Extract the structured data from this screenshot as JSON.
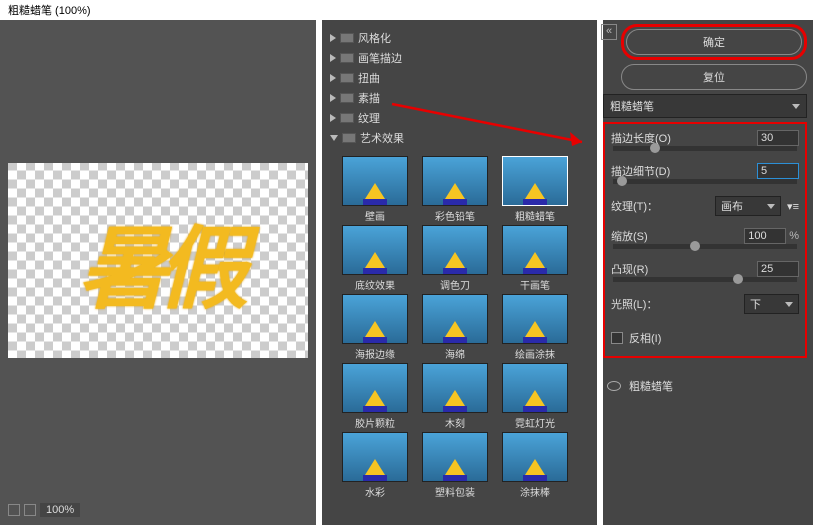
{
  "title": "粗糙蜡笔 (100%)",
  "preview": {
    "text": "暑假",
    "zoom": "100%"
  },
  "folders": [
    {
      "label": "风格化",
      "expanded": false
    },
    {
      "label": "画笔描边",
      "expanded": false
    },
    {
      "label": "扭曲",
      "expanded": false
    },
    {
      "label": "素描",
      "expanded": false
    },
    {
      "label": "纹理",
      "expanded": false
    },
    {
      "label": "艺术效果",
      "expanded": true
    }
  ],
  "thumbnails": [
    {
      "label": "壁画",
      "sel": false
    },
    {
      "label": "彩色铅笔",
      "sel": false
    },
    {
      "label": "粗糙蜡笔",
      "sel": true
    },
    {
      "label": "底纹效果",
      "sel": false
    },
    {
      "label": "调色刀",
      "sel": false
    },
    {
      "label": "干画笔",
      "sel": false
    },
    {
      "label": "海报边缘",
      "sel": false
    },
    {
      "label": "海绵",
      "sel": false
    },
    {
      "label": "绘画涂抹",
      "sel": false
    },
    {
      "label": "胶片颗粒",
      "sel": false
    },
    {
      "label": "木刻",
      "sel": false
    },
    {
      "label": "霓虹灯光",
      "sel": false
    },
    {
      "label": "水彩",
      "sel": false
    },
    {
      "label": "塑料包装",
      "sel": false
    },
    {
      "label": "涂抹棒",
      "sel": false
    }
  ],
  "buttons": {
    "ok": "确定",
    "reset": "复位"
  },
  "filterSelect": "粗糙蜡笔",
  "params": {
    "strokeLength": {
      "label": "描边长度(O)",
      "value": "30"
    },
    "strokeDetail": {
      "label": "描边细节(D)",
      "value": "5"
    },
    "texture": {
      "label": "纹理(T)：",
      "value": "画布"
    },
    "scaling": {
      "label": "缩放(S)",
      "value": "100",
      "unit": "%"
    },
    "relief": {
      "label": "凸现(R)",
      "value": "25"
    },
    "light": {
      "label": "光照(L)：",
      "value": "下"
    },
    "invert": {
      "label": "反相(I)",
      "checked": false
    }
  },
  "layer": {
    "name": "粗糙蜡笔"
  }
}
